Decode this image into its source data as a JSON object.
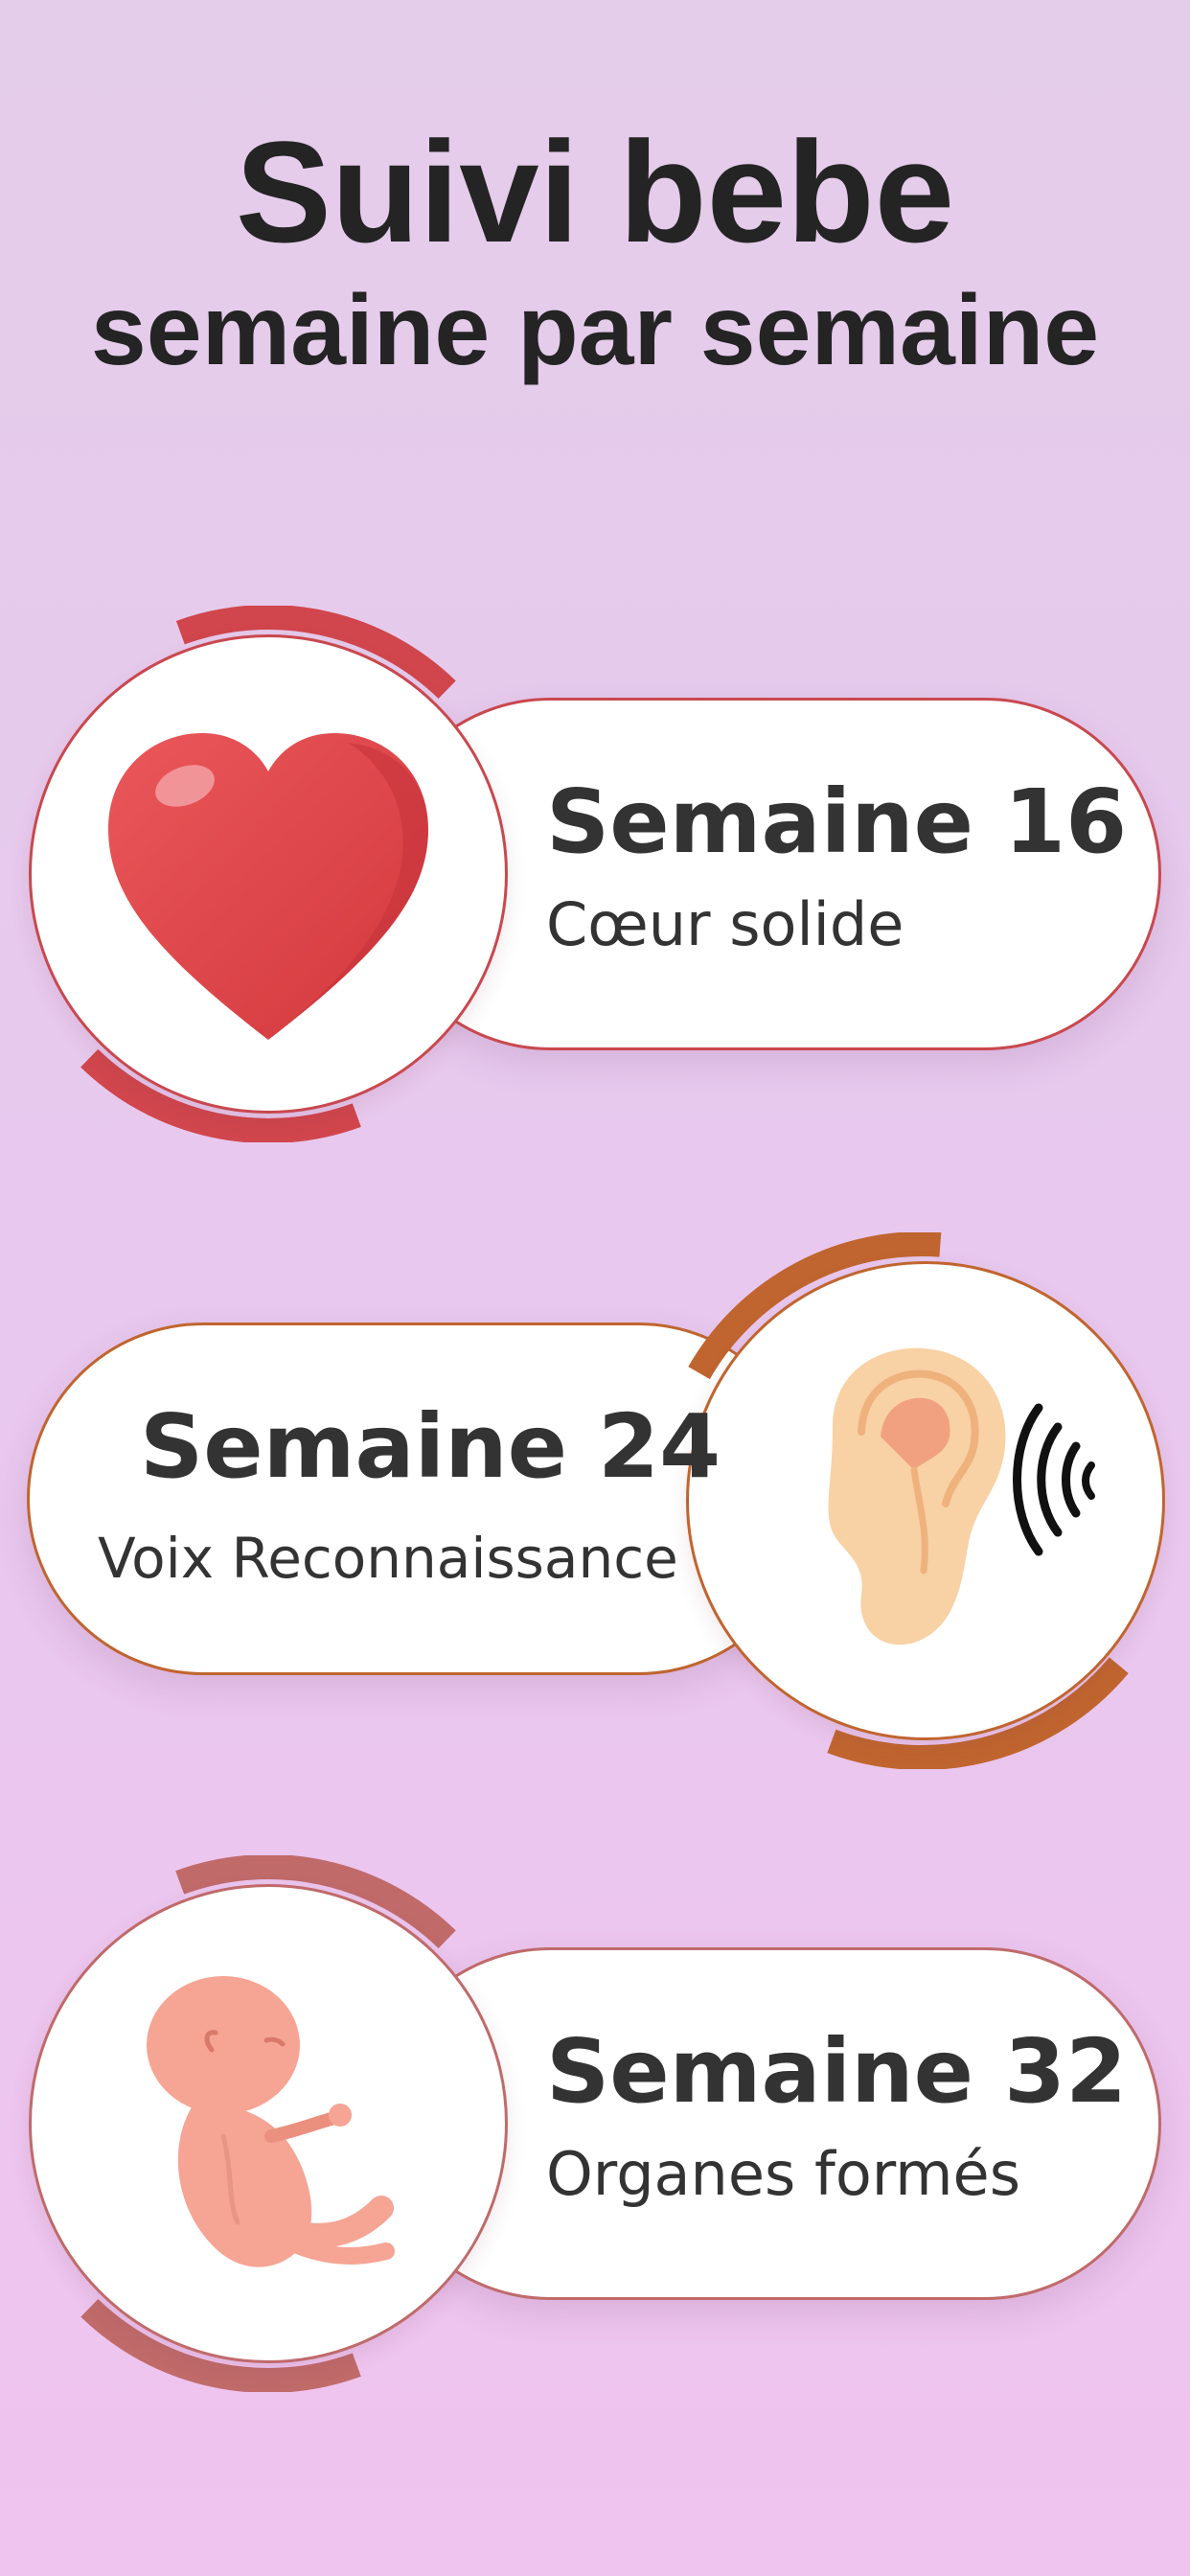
{
  "header": {
    "title": "Suivi bebe",
    "subtitle": "semaine par semaine"
  },
  "cards": [
    {
      "week": "Semaine 16",
      "caption": "Cœur solide",
      "icon": "heart-icon",
      "accent": "#d0464c"
    },
    {
      "week": "Semaine 24",
      "caption": "Voix Reconnaissance",
      "icon": "ear-icon",
      "accent": "#c0652f"
    },
    {
      "week": "Semaine 32",
      "caption": "Organes formés",
      "icon": "fetus-icon",
      "accent": "#c06a6a"
    }
  ]
}
